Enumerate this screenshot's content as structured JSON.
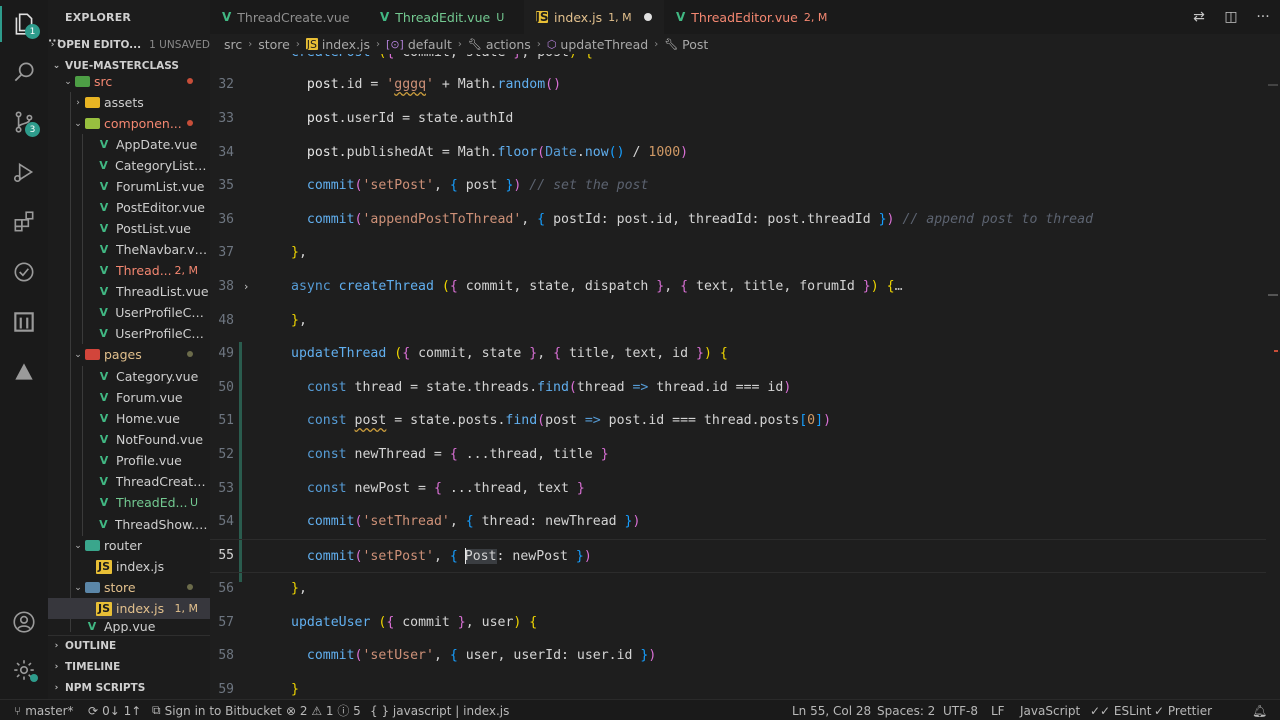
{
  "sidebar": {
    "title": "EXPLORER",
    "more": "···",
    "open_editors": {
      "label": "OPEN EDITO...",
      "extra": "1 UNSAVED"
    },
    "project": "VUE-MASTERCLASS",
    "tree": [
      {
        "name": "src",
        "status": ""
      },
      {
        "name": "assets",
        "status": ""
      },
      {
        "name": "componen...",
        "status": ""
      },
      {
        "name": "AppDate.vue",
        "status": ""
      },
      {
        "name": "CategoryList.v...",
        "status": ""
      },
      {
        "name": "ForumList.vue",
        "status": ""
      },
      {
        "name": "PostEditor.vue",
        "status": ""
      },
      {
        "name": "PostList.vue",
        "status": ""
      },
      {
        "name": "TheNavbar.vue",
        "status": ""
      },
      {
        "name": "Thread...",
        "status": "2, M"
      },
      {
        "name": "ThreadList.vue",
        "status": ""
      },
      {
        "name": "UserProfileCar...",
        "status": ""
      },
      {
        "name": "UserProfileCar...",
        "status": ""
      },
      {
        "name": "pages",
        "status": ""
      },
      {
        "name": "Category.vue",
        "status": ""
      },
      {
        "name": "Forum.vue",
        "status": ""
      },
      {
        "name": "Home.vue",
        "status": ""
      },
      {
        "name": "NotFound.vue",
        "status": ""
      },
      {
        "name": "Profile.vue",
        "status": ""
      },
      {
        "name": "ThreadCreate...",
        "status": ""
      },
      {
        "name": "ThreadEd...",
        "status": "U"
      },
      {
        "name": "ThreadShow.vue",
        "status": ""
      },
      {
        "name": "router",
        "status": ""
      },
      {
        "name": "index.js",
        "status": ""
      },
      {
        "name": "store",
        "status": ""
      },
      {
        "name": "index.js",
        "status": "1, M"
      },
      {
        "name": "App.vue",
        "status": ""
      }
    ],
    "sections": [
      "OUTLINE",
      "TIMELINE",
      "NPM SCRIPTS"
    ]
  },
  "tabs": [
    {
      "label": "ThreadCreate.vue",
      "status": ""
    },
    {
      "label": "ThreadEdit.vue",
      "status": "U"
    },
    {
      "label": "index.js",
      "status": "1, M"
    },
    {
      "label": "ThreadEditor.vue",
      "status": "2, M"
    }
  ],
  "breadcrumb": [
    "src",
    "store",
    "index.js",
    "default",
    "actions",
    "updateThread",
    "Post"
  ],
  "activity_badges": {
    "explorer": "1",
    "scm": "3"
  },
  "editor": {
    "line_numbers": [
      "32",
      "33",
      "34",
      "35",
      "36",
      "37",
      "38",
      "48",
      "49",
      "50",
      "51",
      "52",
      "53",
      "54",
      "55",
      "56",
      "57",
      "58",
      "59"
    ]
  },
  "status": {
    "branch": "master*",
    "sync": "0↓ 1↑",
    "bitbucket": "Sign in to Bitbucket",
    "problems": "⊗ 2 ⚠ 1 ⓘ 5",
    "language_crumb": "{ } javascript | index.js",
    "position": "Ln 55, Col 28",
    "spaces": "Spaces: 2",
    "encoding": "UTF-8",
    "eol": "LF",
    "language": "JavaScript",
    "eslint": "✓✓ ESLint",
    "prettier": "✓ Prettier"
  },
  "colors": {
    "accent": "#2e9c8c",
    "modified": "#e2c08d",
    "error": "#f48771",
    "untracked": "#73c991"
  }
}
